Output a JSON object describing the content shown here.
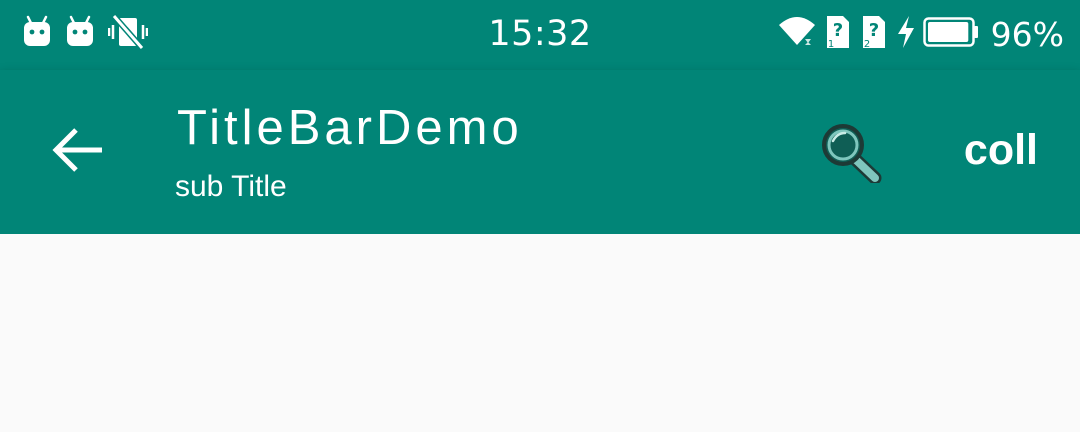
{
  "status_bar": {
    "time": "15:32",
    "battery_percent": "96%",
    "battery_level": 0.96,
    "left_icons": [
      "android-icon",
      "android-icon",
      "vibrate-off-icon"
    ],
    "right_icons": [
      "wifi-icon",
      "sim-unknown-icon",
      "sim-unknown-icon",
      "charging-bolt-icon",
      "battery-icon"
    ]
  },
  "toolbar": {
    "title": "TitleBarDemo",
    "subtitle": "sub Title",
    "action_label": "coll",
    "back_icon": "arrow-back-icon",
    "search_icon": "search-icon"
  },
  "colors": {
    "primary": "#018577",
    "background": "#fafafa",
    "on_primary": "#ffffff",
    "search_icon_fill": "#7fc6bd"
  }
}
